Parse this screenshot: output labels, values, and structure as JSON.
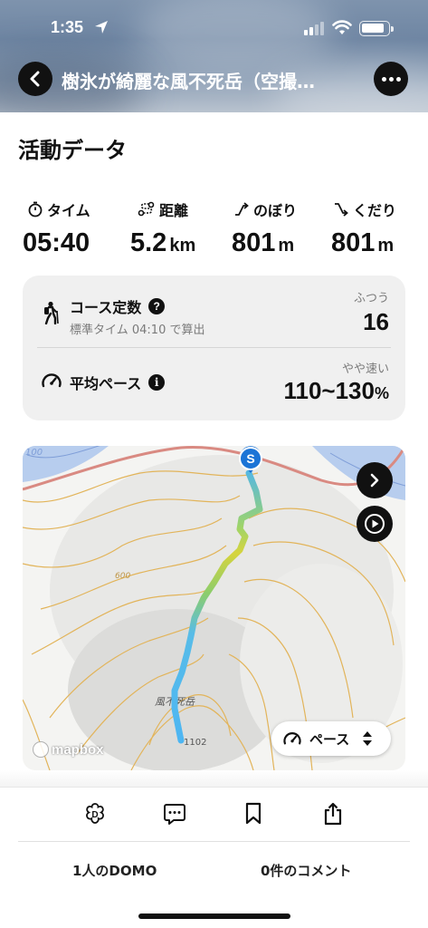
{
  "status_bar": {
    "time": "1:35"
  },
  "nav": {
    "title": "樹氷が綺麗な風不死岳（空撮…"
  },
  "section": {
    "title": "活動データ"
  },
  "stats": [
    {
      "label": "タイム",
      "icon": "stopwatch-icon",
      "value": "05:40",
      "unit": ""
    },
    {
      "label": "距離",
      "icon": "route-icon",
      "value": "5.2",
      "unit": "km"
    },
    {
      "label": "のぼり",
      "icon": "ascent-icon",
      "value": "801",
      "unit": "m"
    },
    {
      "label": "くだり",
      "icon": "descent-icon",
      "value": "801",
      "unit": "m"
    }
  ],
  "course": {
    "label": "コース定数",
    "sub": "標準タイム 04:10 で算出",
    "rating": "ふつう",
    "value": "16"
  },
  "pace": {
    "label": "平均ペース",
    "rating": "やや速い",
    "value": "110~130",
    "unit": "%"
  },
  "map": {
    "contour_label_600": "600",
    "contour_label_100": "100",
    "summit_name": "風不死岳",
    "summit_elevation": "1102",
    "start_marker": "S",
    "attribution": "mapbox",
    "pace_button_label": "ペース"
  },
  "footer": {
    "domo_count": "1人のDOMO",
    "comment_count": "0件のコメント"
  },
  "colors": {
    "route_start": "#8fd16a",
    "route_end": "#4fb8f0",
    "contour": "#e2b45a",
    "road": "#d98a82",
    "water": "#b7cdee"
  }
}
